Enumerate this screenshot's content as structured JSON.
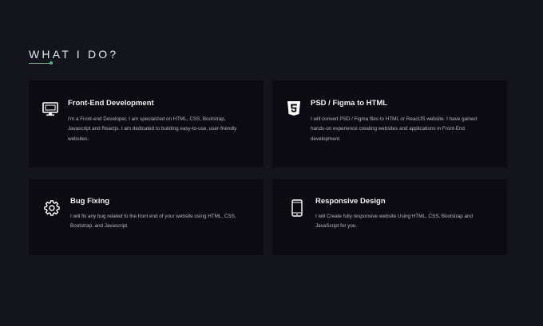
{
  "section": {
    "title": "WHAT I DO?"
  },
  "services": [
    {
      "icon": "monitor-icon",
      "title": "Front-End Development",
      "description": "I'm a Front-end Developer. I am specialized on HTML, CSS, Bootstrap, Javascript and Reactjs. I am dedicated to building easy-to-use, user-friendly websites."
    },
    {
      "icon": "html5-icon",
      "title": "PSD / Figma to HTML",
      "description": "I will convert PSD / Figma files to HTML or ReactJS website. I have gained hands-on experience creating websites and applications in Front-End development."
    },
    {
      "icon": "gear-icon",
      "title": "Bug Fixing",
      "description": "I will fix any bug related to the front end of your website using HTML, CSS, Bootstrap, and Javascript."
    },
    {
      "icon": "smartphone-icon",
      "title": "Responsive Design",
      "description": "I will Create fully responsive website Using HTML, CSS, Bootstrap and JavaScript for you."
    }
  ],
  "colors": {
    "background": "#14141d",
    "card": "#0b0b11",
    "accent": "#41c18c"
  }
}
